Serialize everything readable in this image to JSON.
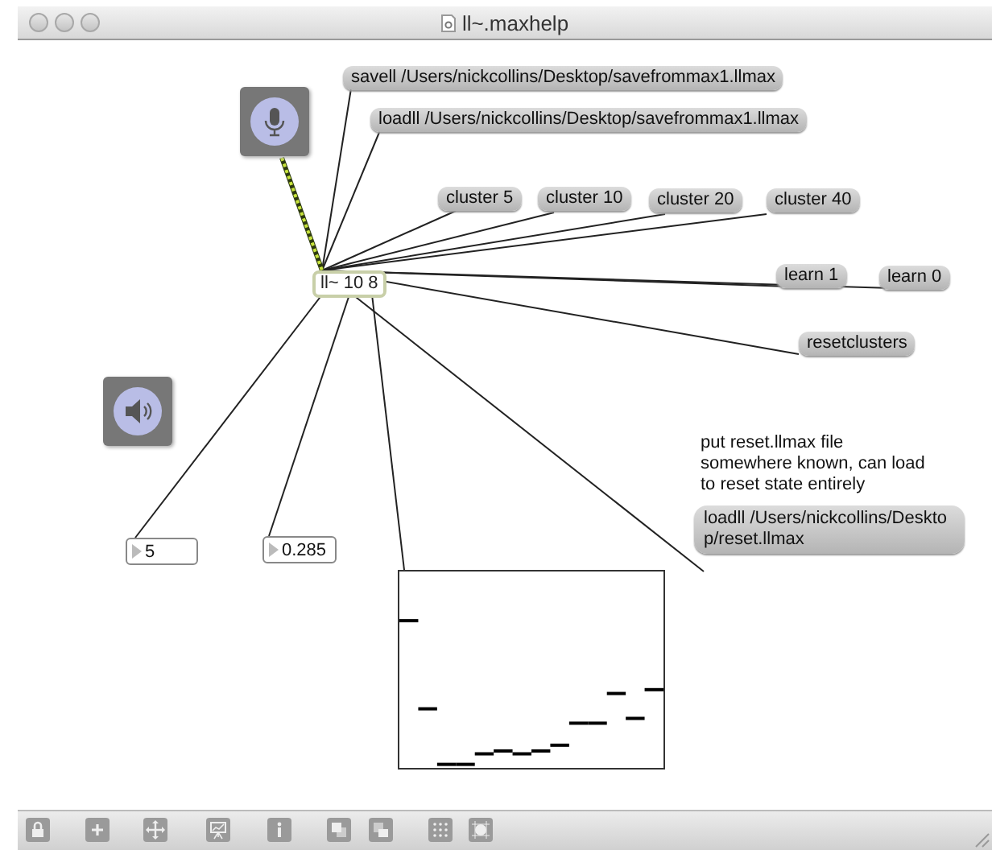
{
  "window": {
    "title": "ll~.maxhelp"
  },
  "messages": [
    {
      "text": "savell /Users/nickcollins/Desktop/savefrommax1.llmax"
    },
    {
      "text": "loadll /Users/nickcollins/Desktop/savefrommax1.llmax"
    },
    {
      "text": "cluster 5"
    },
    {
      "text": "cluster 10"
    },
    {
      "text": "cluster 20"
    },
    {
      "text": "cluster 40"
    },
    {
      "text": "learn 1"
    },
    {
      "text": "learn 0"
    },
    {
      "text": "resetclusters"
    },
    {
      "text": "loadll /Users/nickcollins/Desktop/reset.llmax"
    }
  ],
  "object_box": {
    "text": "ll~ 10 8"
  },
  "comment": "put reset.llmax file somewhere known, can load to reset state entirely",
  "number_boxes": [
    {
      "value": "5"
    },
    {
      "value": "0.285"
    }
  ]
}
